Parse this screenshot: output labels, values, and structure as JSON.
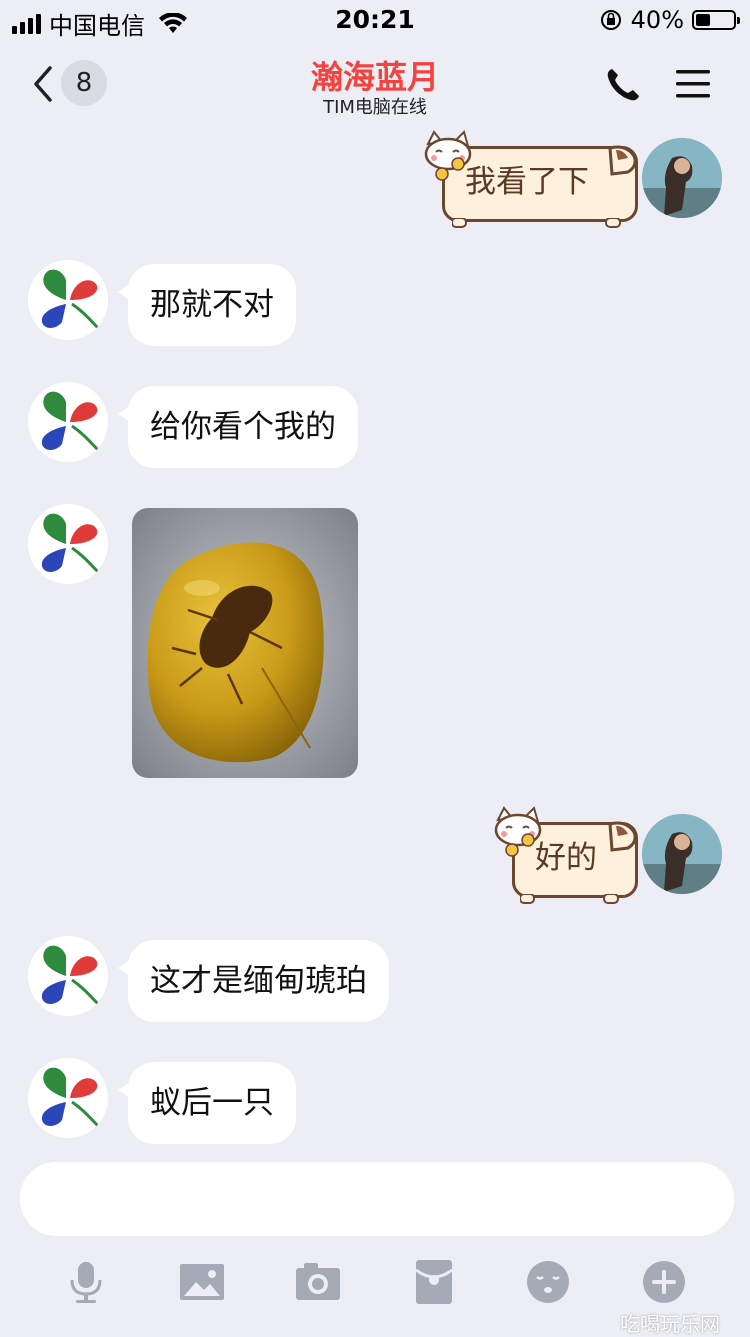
{
  "status_bar": {
    "carrier": "中国电信",
    "time": "20:21",
    "battery_percent": "40%",
    "battery_level": 0.4
  },
  "nav": {
    "unread_count": "8",
    "title": "瀚海蓝月",
    "subtitle": "TIM电脑在线"
  },
  "messages": [
    {
      "from": "self",
      "type": "text",
      "text": "我看了下"
    },
    {
      "from": "other",
      "type": "text",
      "text": "那就不对"
    },
    {
      "from": "other",
      "type": "text",
      "text": "给你看个我的"
    },
    {
      "from": "other",
      "type": "image",
      "icon": "amber-photo"
    },
    {
      "from": "self",
      "type": "text",
      "text": "好的"
    },
    {
      "from": "other",
      "type": "text",
      "text": "这才是缅甸琥珀"
    },
    {
      "from": "other",
      "type": "text",
      "text": "蚁后一只"
    }
  ],
  "input": {
    "placeholder": ""
  },
  "toolbar": [
    "microphone-icon",
    "image-icon",
    "camera-icon",
    "red-packet-icon",
    "emoji-icon",
    "plus-icon"
  ],
  "watermark": "吃喝玩乐网",
  "colors": {
    "title": "#f2433e",
    "background": "#ecedf5",
    "icon": "#a6a9b6"
  }
}
